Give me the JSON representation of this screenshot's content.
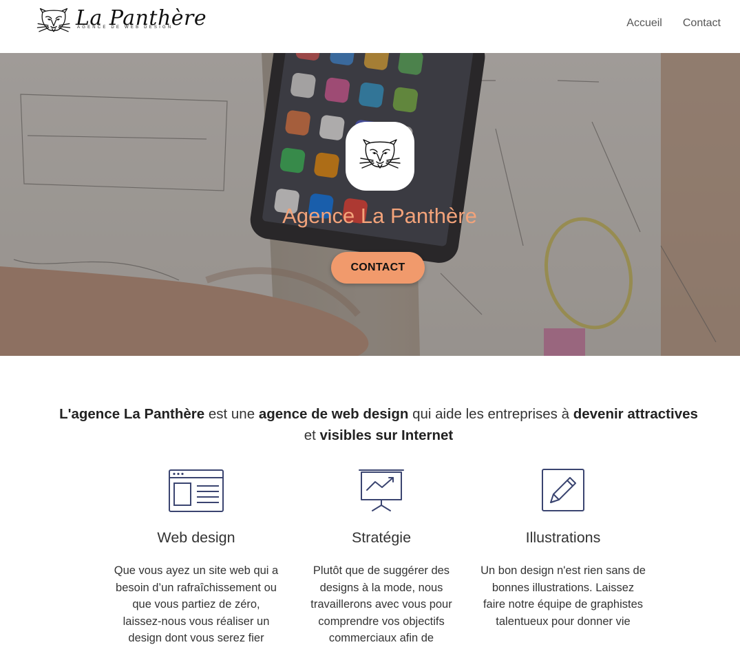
{
  "header": {
    "logo_title": "La Panthère",
    "logo_tagline": "AGENCE DE WEB DESIGN",
    "logo_icon": "panther-icon",
    "nav": [
      {
        "label": "Accueil"
      },
      {
        "label": "Contact"
      }
    ]
  },
  "hero": {
    "badge_icon": "panther-icon",
    "title": "Agence La Panthère",
    "cta_label": "CONTACT",
    "colors": {
      "title": "#f3a37a",
      "cta": "#f19a6c"
    }
  },
  "intro": {
    "parts": [
      {
        "text": "L'agence La Panthère",
        "bold": true
      },
      {
        "text": " est une ",
        "bold": false
      },
      {
        "text": "agence de web design",
        "bold": true
      },
      {
        "text": " qui aide les entreprises à ",
        "bold": false
      },
      {
        "text": "devenir attractives",
        "bold": true
      },
      {
        "text": " et ",
        "bold": false
      },
      {
        "text": "visibles sur Internet",
        "bold": true
      }
    ]
  },
  "features": [
    {
      "icon": "web-layout-icon",
      "title": "Web design",
      "text": "Que vous ayez un site web qui a besoin d’un rafraîchissement ou que vous partiez de zéro, laissez-nous vous réaliser un design dont vous serez fier"
    },
    {
      "icon": "presentation-chart-icon",
      "title": "Stratégie",
      "text": "Plutôt que de suggérer des designs à la mode, nous travaillerons avec vous pour comprendre vos objectifs commerciaux afin de"
    },
    {
      "icon": "pencil-icon",
      "title": "Illustrations",
      "text": "Un bon design n'est rien sans de bonnes illustrations. Laissez faire notre équipe de graphistes talentueux pour donner vie"
    }
  ]
}
